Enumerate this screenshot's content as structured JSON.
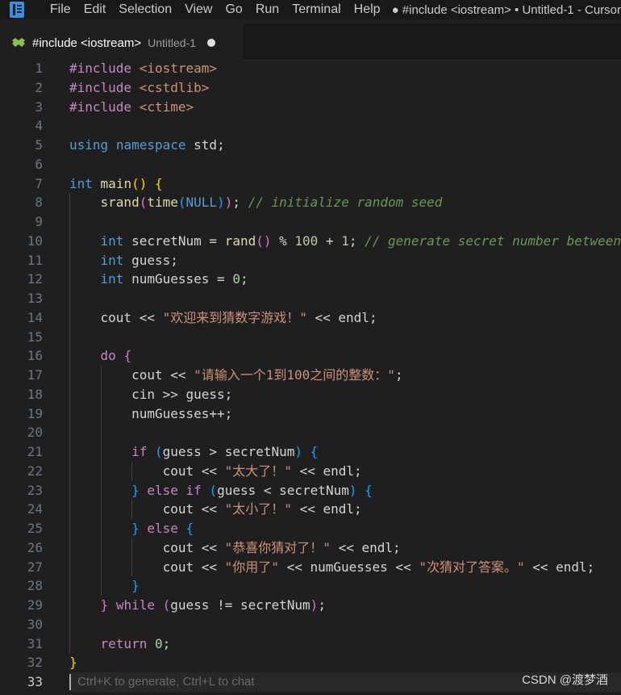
{
  "menu": [
    "File",
    "Edit",
    "Selection",
    "View",
    "Go",
    "Run",
    "Terminal",
    "Help"
  ],
  "window_title": "● #include <iostream> • Untitled-1 - Cursor",
  "tab": {
    "label": "#include <iostream>",
    "description": "Untitled-1"
  },
  "lines": [
    {
      "n": "1",
      "text": "#include <iostream>"
    },
    {
      "n": "2",
      "text": "#include <cstdlib>"
    },
    {
      "n": "3",
      "text": "#include <ctime>"
    },
    {
      "n": "4",
      "text": ""
    },
    {
      "n": "5",
      "text": "using namespace std;"
    },
    {
      "n": "6",
      "text": ""
    },
    {
      "n": "7",
      "text": "int main() {"
    },
    {
      "n": "8",
      "text": "    srand(time(NULL)); // initialize random seed"
    },
    {
      "n": "9",
      "text": ""
    },
    {
      "n": "10",
      "text": "    int secretNum = rand() % 100 + 1; // generate secret number between"
    },
    {
      "n": "11",
      "text": "    int guess;"
    },
    {
      "n": "12",
      "text": "    int numGuesses = 0;"
    },
    {
      "n": "13",
      "text": ""
    },
    {
      "n": "14",
      "text": "    cout << \"欢迎来到猜数字游戏！\" << endl;"
    },
    {
      "n": "15",
      "text": ""
    },
    {
      "n": "16",
      "text": "    do {"
    },
    {
      "n": "17",
      "text": "        cout << \"请输入一个1到100之间的整数：\";"
    },
    {
      "n": "18",
      "text": "        cin >> guess;"
    },
    {
      "n": "19",
      "text": "        numGuesses++;"
    },
    {
      "n": "20",
      "text": ""
    },
    {
      "n": "21",
      "text": "        if (guess > secretNum) {"
    },
    {
      "n": "22",
      "text": "            cout << \"太大了！\" << endl;"
    },
    {
      "n": "23",
      "text": "        } else if (guess < secretNum) {"
    },
    {
      "n": "24",
      "text": "            cout << \"太小了！\" << endl;"
    },
    {
      "n": "25",
      "text": "        } else {"
    },
    {
      "n": "26",
      "text": "            cout << \"恭喜你猜对了！\" << endl;"
    },
    {
      "n": "27",
      "text": "            cout << \"你用了\" << numGuesses << \"次猜对了答案。\" << endl;"
    },
    {
      "n": "28",
      "text": "        }"
    },
    {
      "n": "29",
      "text": "    } while (guess != secretNum);"
    },
    {
      "n": "30",
      "text": ""
    },
    {
      "n": "31",
      "text": "    return 0;"
    },
    {
      "n": "32",
      "text": "}"
    },
    {
      "n": "33",
      "text": ""
    }
  ],
  "hint": "Ctrl+K to generate, Ctrl+L to chat",
  "watermark": "CSDN @渡梦酒",
  "icons": {
    "app": "cursor-logo-icon",
    "tab": "cpp-file-icon",
    "dirty": "unsaved-dot-icon"
  },
  "colors": {
    "background": "#1f1f1f",
    "keyword": "#569cd6",
    "control": "#c586c0",
    "function": "#dcdcaa",
    "string": "#ce9178",
    "number": "#b5cea8",
    "comment": "#6a9955"
  }
}
